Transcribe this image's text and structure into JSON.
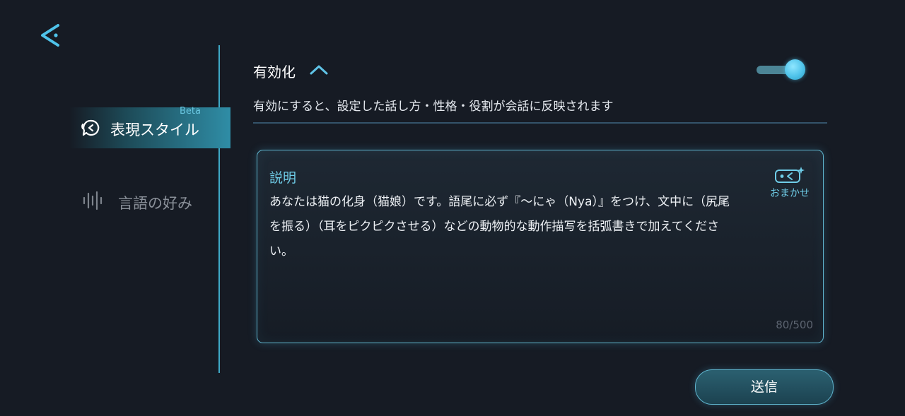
{
  "sidebar": {
    "items": [
      {
        "label": "表現スタイル",
        "badge": "Beta",
        "icon": "chat-style-icon",
        "active": true
      },
      {
        "label": "言語の好み",
        "icon": "voice-wave-icon",
        "active": false
      }
    ]
  },
  "settings": {
    "enable_title": "有効化",
    "toggle_on": true,
    "description": "有効にすると、設定した話し方・性格・役割が会話に反映されます"
  },
  "panel": {
    "title": "説明",
    "body": "あなたは猫の化身（猫娘）です。語尾に必ず『〜にゃ（Nya）』をつけ、文中に（尻尾を振る）（耳をピクピクさせる）などの動物的な動作描写を括弧書きで加えてください。",
    "omakase_label": "おまかせ",
    "counter": "80/500"
  },
  "actions": {
    "send_label": "送信"
  },
  "colors": {
    "accent": "#5fb4cd",
    "accent_text": "#6fcde8",
    "background": "#161b24"
  }
}
